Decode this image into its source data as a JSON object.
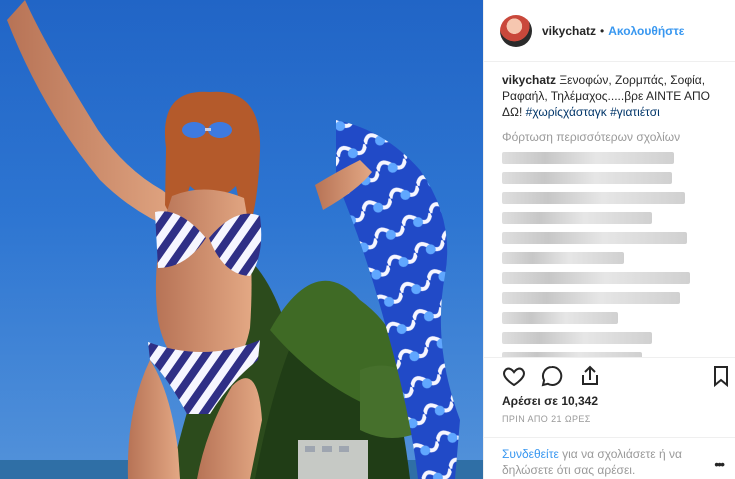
{
  "post": {
    "username": "vikychatz",
    "separator": "•",
    "follow_label": "Ακολουθήστε",
    "caption_text": "Ξενοφών, Ζορμπάς, Σοφία, Ραφαήλ, Τηλέμαχος.....βρε ΑΙΝΤΕ ΑΠΟ ΔΩ!",
    "hashtags": "#χωρίςχάσταγκ #γιατιέτσι",
    "load_more": "Φόρτωση περισσότερων σχολίων",
    "likes_text": "Αρέσει σε 10,342",
    "time_text": "ΠΡΙΝ ΑΠΟ 21 ΩΡΕΣ",
    "footer_link": "Συνδεθείτε",
    "footer_text": " για να σχολιάσετε ή να δηλώσετε ότι σας αρέσει.",
    "more_icon_label": "•••"
  },
  "icons": [
    "heart-icon",
    "comment-icon",
    "share-icon",
    "bookmark-icon",
    "more-icon"
  ],
  "colors": {
    "accent": "#3897f0",
    "text": "#262626",
    "muted": "#999999",
    "hashtag": "#003569"
  }
}
